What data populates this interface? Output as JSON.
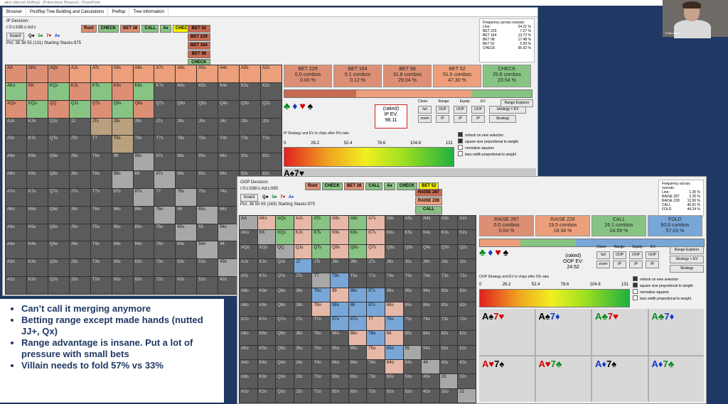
{
  "window_title": "ation (discord-Shifting) - [Pokeroboss Pleasure] - PowerPoint",
  "tabs": [
    "Browser",
    "Postflop Tree Building and Calculations",
    "Preflop",
    "Tree information"
  ],
  "ip_panel": {
    "decision": "IP Decision:",
    "line": "r:0:c:b38:c:Ad:c",
    "board_button": "board",
    "board_cards": [
      "Q♣",
      "5♣",
      "7♥",
      "A♦"
    ],
    "pot": "Pot: 38 38 55 (131) Starting Stacks:975",
    "action_path": [
      {
        "label": "Root",
        "color": "#dc8f74"
      },
      {
        "label": "CHECK",
        "color": "#87c383"
      },
      {
        "label": "BET 38",
        "color": "#dc8f74"
      },
      {
        "label": "CALL",
        "color": "#87c383"
      },
      {
        "label": "A♦",
        "color": "#87c383"
      },
      {
        "label": "CHECK",
        "color": "#f4f000"
      }
    ],
    "bet_options": [
      "BET 52",
      "BET 229",
      "BET 164",
      "BET 98",
      "CHECK"
    ],
    "freq_title": "Frequency across runouts:",
    "freq": [
      [
        "Line:",
        "24.21 %"
      ],
      [
        "BET 229",
        "7.27 %"
      ],
      [
        "BET 164",
        "13.72 %"
      ],
      [
        "BET 98",
        "17.48 %"
      ],
      [
        "BET 52",
        "5.59 %"
      ],
      [
        "CHECK",
        "55.92 %"
      ]
    ],
    "actions": [
      {
        "label": "BET 229",
        "combos": "0.0 combos",
        "pct": "0.00 %",
        "color": "#dc8f74"
      },
      {
        "label": "BET 164",
        "combos": "0.1 combos",
        "pct": "0.12 %",
        "color": "#dc8f74"
      },
      {
        "label": "BET 98",
        "combos": "31.8 combos",
        "pct": "29.04 %",
        "color": "#dc8f74"
      },
      {
        "label": "BET 52",
        "combos": "51.5 combos",
        "pct": "47.30 %",
        "color": "#ec9f7a"
      },
      {
        "label": "CHECK",
        "combos": "25.6 combos",
        "pct": "23.54 %",
        "color": "#87c383"
      }
    ],
    "ev_label": "(raked)",
    "ev_title": "IP EV:",
    "ev_value": "98.11",
    "clone": "Clone:",
    "range": "Range:",
    "equity": "Equity:",
    "ev": "EV:",
    "btn_full": "full",
    "btn_zoom": "zoom",
    "btn_oop": "OOP",
    "btn_ip": "IP",
    "range_explorer": "Range Explorer",
    "strategy_ev": "Strategy + EV",
    "strategy": "Strategy",
    "legend_caption": "IP Strategy and EV in chips after 5% rake",
    "scale": [
      "0",
      "26.2",
      "52.4",
      "78.6",
      "104.8",
      "131"
    ],
    "checks": [
      {
        "label": "refresh on new selection",
        "on": true
      },
      {
        "label": "square size proportional to weight",
        "on": true
      },
      {
        "label": "normalize squares",
        "on": false
      },
      {
        "label": "bars width proportional to weight",
        "on": false
      }
    ]
  },
  "oop_panel": {
    "decision": "OOP Decision:",
    "line": "r:0:c:b38:c:Ad:c:b50",
    "board_button": "board",
    "board_cards": [
      "Q♣",
      "5♣",
      "7♥",
      "A♦"
    ],
    "pot": "Pot: 38 50 55 (163) Starting Stacks:975",
    "action_path": [
      {
        "label": "Root",
        "color": "#dc8f74"
      },
      {
        "label": "CHECK",
        "color": "#87c383"
      },
      {
        "label": "BET 38",
        "color": "#dc8f74"
      },
      {
        "label": "CALL",
        "color": "#87c383"
      },
      {
        "label": "A♦",
        "color": "#87c383"
      },
      {
        "label": "CHECK",
        "color": "#87c383"
      },
      {
        "label": "BET 52",
        "color": "#f4f000"
      }
    ],
    "raise_options": [
      "RAISE 287",
      "RAISE 228",
      "CALL",
      "FOLD"
    ],
    "freq_title": "Frequency across runouts:",
    "freq": [
      [
        "Line:",
        "1.35 %"
      ],
      [
        "RAISE 287",
        "2.25 %"
      ],
      [
        "RAISE 228",
        "12.90 %"
      ],
      [
        "CALL",
        "40.61 %"
      ],
      [
        "FOLD",
        "44.24 %"
      ]
    ],
    "actions": [
      {
        "label": "RAISE 287",
        "combos": "0.0 combos",
        "pct": "0.04 %",
        "color": "#dc8f74"
      },
      {
        "label": "RAISE 228",
        "combos": "19.5 combos",
        "pct": "18.34 %",
        "color": "#ec9f7a"
      },
      {
        "label": "CALL",
        "combos": "26.1 combos",
        "pct": "24.59 %",
        "color": "#87c383"
      },
      {
        "label": "FOLD",
        "combos": "60.6 combos",
        "pct": "57.03 %",
        "color": "#78a6d7"
      }
    ],
    "ev_label": "(raked)",
    "ev_title": "OOP EV:",
    "ev_value": "24.52",
    "legend_caption": "OOP Strategy and EV in chips after 5% rake",
    "scale": [
      "0",
      "26.2",
      "52.4",
      "78.6",
      "104.8",
      "131"
    ],
    "cards": [
      "A♠ 7♥",
      "A♠ 7♦",
      "A♣ 7♥",
      "A♣ 7♦",
      "A♥ 7♠",
      "A♥ 7♣",
      "A♦ 7♠",
      "A♦ 7♣"
    ]
  },
  "hands": [
    [
      "AA",
      "AKs",
      "AQs",
      "AJs",
      "ATs",
      "A9s",
      "A8s",
      "A7s",
      "A6s",
      "A5s",
      "A4s",
      "A3s",
      "A2s"
    ],
    [
      "AKo",
      "KK",
      "KQs",
      "KJs",
      "KTs",
      "K9s",
      "K8s",
      "K7s",
      "K6s",
      "K5s",
      "K4s",
      "K3s",
      "K2s"
    ],
    [
      "AQo",
      "KQo",
      "QQ",
      "QJs",
      "QTs",
      "Q9s",
      "Q8s",
      "Q7s",
      "Q6s",
      "Q5s",
      "Q4s",
      "Q3s",
      "Q2s"
    ],
    [
      "AJo",
      "KJo",
      "QJo",
      "JJ",
      "JTs",
      "J9s",
      "J8s",
      "J7s",
      "J6s",
      "J5s",
      "J4s",
      "J3s",
      "J2s"
    ],
    [
      "ATo",
      "KTo",
      "QTo",
      "JTo",
      "TT",
      "T9s",
      "T8s",
      "T7s",
      "T6s",
      "T5s",
      "T4s",
      "T3s",
      "T2s"
    ],
    [
      "A9o",
      "K9o",
      "Q9o",
      "J9o",
      "T9o",
      "99",
      "98s",
      "97s",
      "96s",
      "95s",
      "94s",
      "93s",
      "92s"
    ],
    [
      "A8o",
      "K8o",
      "Q8o",
      "J8o",
      "T8o",
      "98o",
      "88",
      "87s",
      "86s",
      "85s",
      "84s",
      "83s",
      "82s"
    ],
    [
      "A7o",
      "K7o",
      "Q7o",
      "J7o",
      "T7o",
      "97o",
      "87o",
      "77",
      "76s",
      "75s",
      "74s",
      "73s",
      "72s"
    ],
    [
      "A6o",
      "K6o",
      "Q6o",
      "J6o",
      "T6o",
      "96o",
      "86o",
      "76o",
      "66",
      "65s",
      "64s",
      "63s",
      "62s"
    ],
    [
      "A5o",
      "K5o",
      "Q5o",
      "J5o",
      "T5o",
      "95o",
      "85o",
      "75o",
      "65o",
      "55",
      "54s",
      "53s",
      "52s"
    ],
    [
      "A4o",
      "K4o",
      "Q4o",
      "J4o",
      "T4o",
      "94o",
      "84o",
      "74o",
      "64o",
      "54o",
      "44",
      "43s",
      "42s"
    ],
    [
      "A3o",
      "K3o",
      "Q3o",
      "J3o",
      "T3o",
      "93o",
      "83o",
      "73o",
      "63o",
      "53o",
      "43o",
      "33",
      "32s"
    ],
    [
      "A2o",
      "K2o",
      "Q2o",
      "J2o",
      "T2o",
      "92o",
      "82o",
      "72o",
      "62o",
      "52o",
      "42o",
      "32o",
      "22"
    ]
  ],
  "bullets": [
    "Can’t call it merging anymore",
    "Betting range except made hands (nutted JJ+, Qx)",
    "Range advantage is insane. Put a lot of pressure with small bets",
    "Villain needs to fold 57% vs 33%"
  ],
  "camera_name": "Pokeroboss"
}
